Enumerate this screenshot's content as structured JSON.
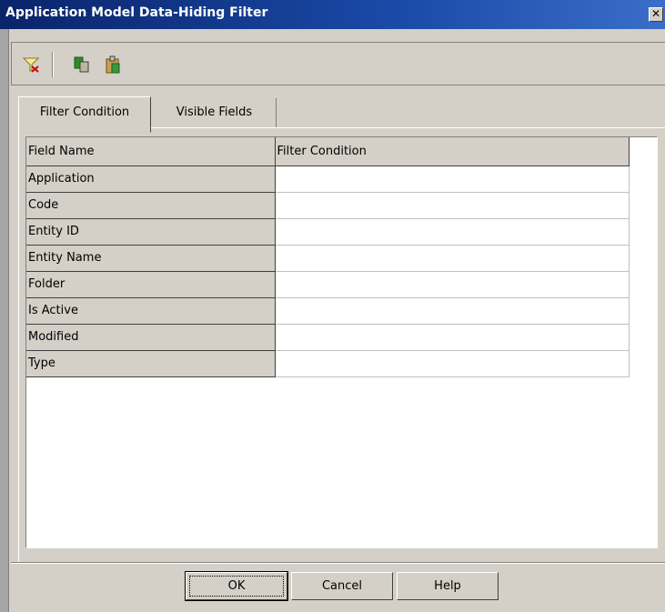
{
  "window": {
    "title": "Application Model Data-Hiding Filter",
    "close_glyph": "✕"
  },
  "toolbar": {
    "icons": [
      "filter-icon",
      "copy-icon",
      "paste-icon"
    ]
  },
  "tabs": [
    {
      "label": "Filter Condition",
      "active": true
    },
    {
      "label": "Visible Fields",
      "active": false
    }
  ],
  "grid": {
    "columns": [
      "Field Name",
      "Filter Condition"
    ],
    "rows": [
      {
        "field": "Application",
        "condition": ""
      },
      {
        "field": "Code",
        "condition": ""
      },
      {
        "field": "Entity ID",
        "condition": ""
      },
      {
        "field": "Entity Name",
        "condition": ""
      },
      {
        "field": "Folder",
        "condition": ""
      },
      {
        "field": "Is Active",
        "condition": ""
      },
      {
        "field": "Modified",
        "condition": ""
      },
      {
        "field": "Type",
        "condition": ""
      }
    ]
  },
  "buttons": {
    "ok": "OK",
    "cancel": "Cancel",
    "help": "Help"
  },
  "colors": {
    "titlebar": "#0a246a",
    "face": "#d4d0c8"
  }
}
